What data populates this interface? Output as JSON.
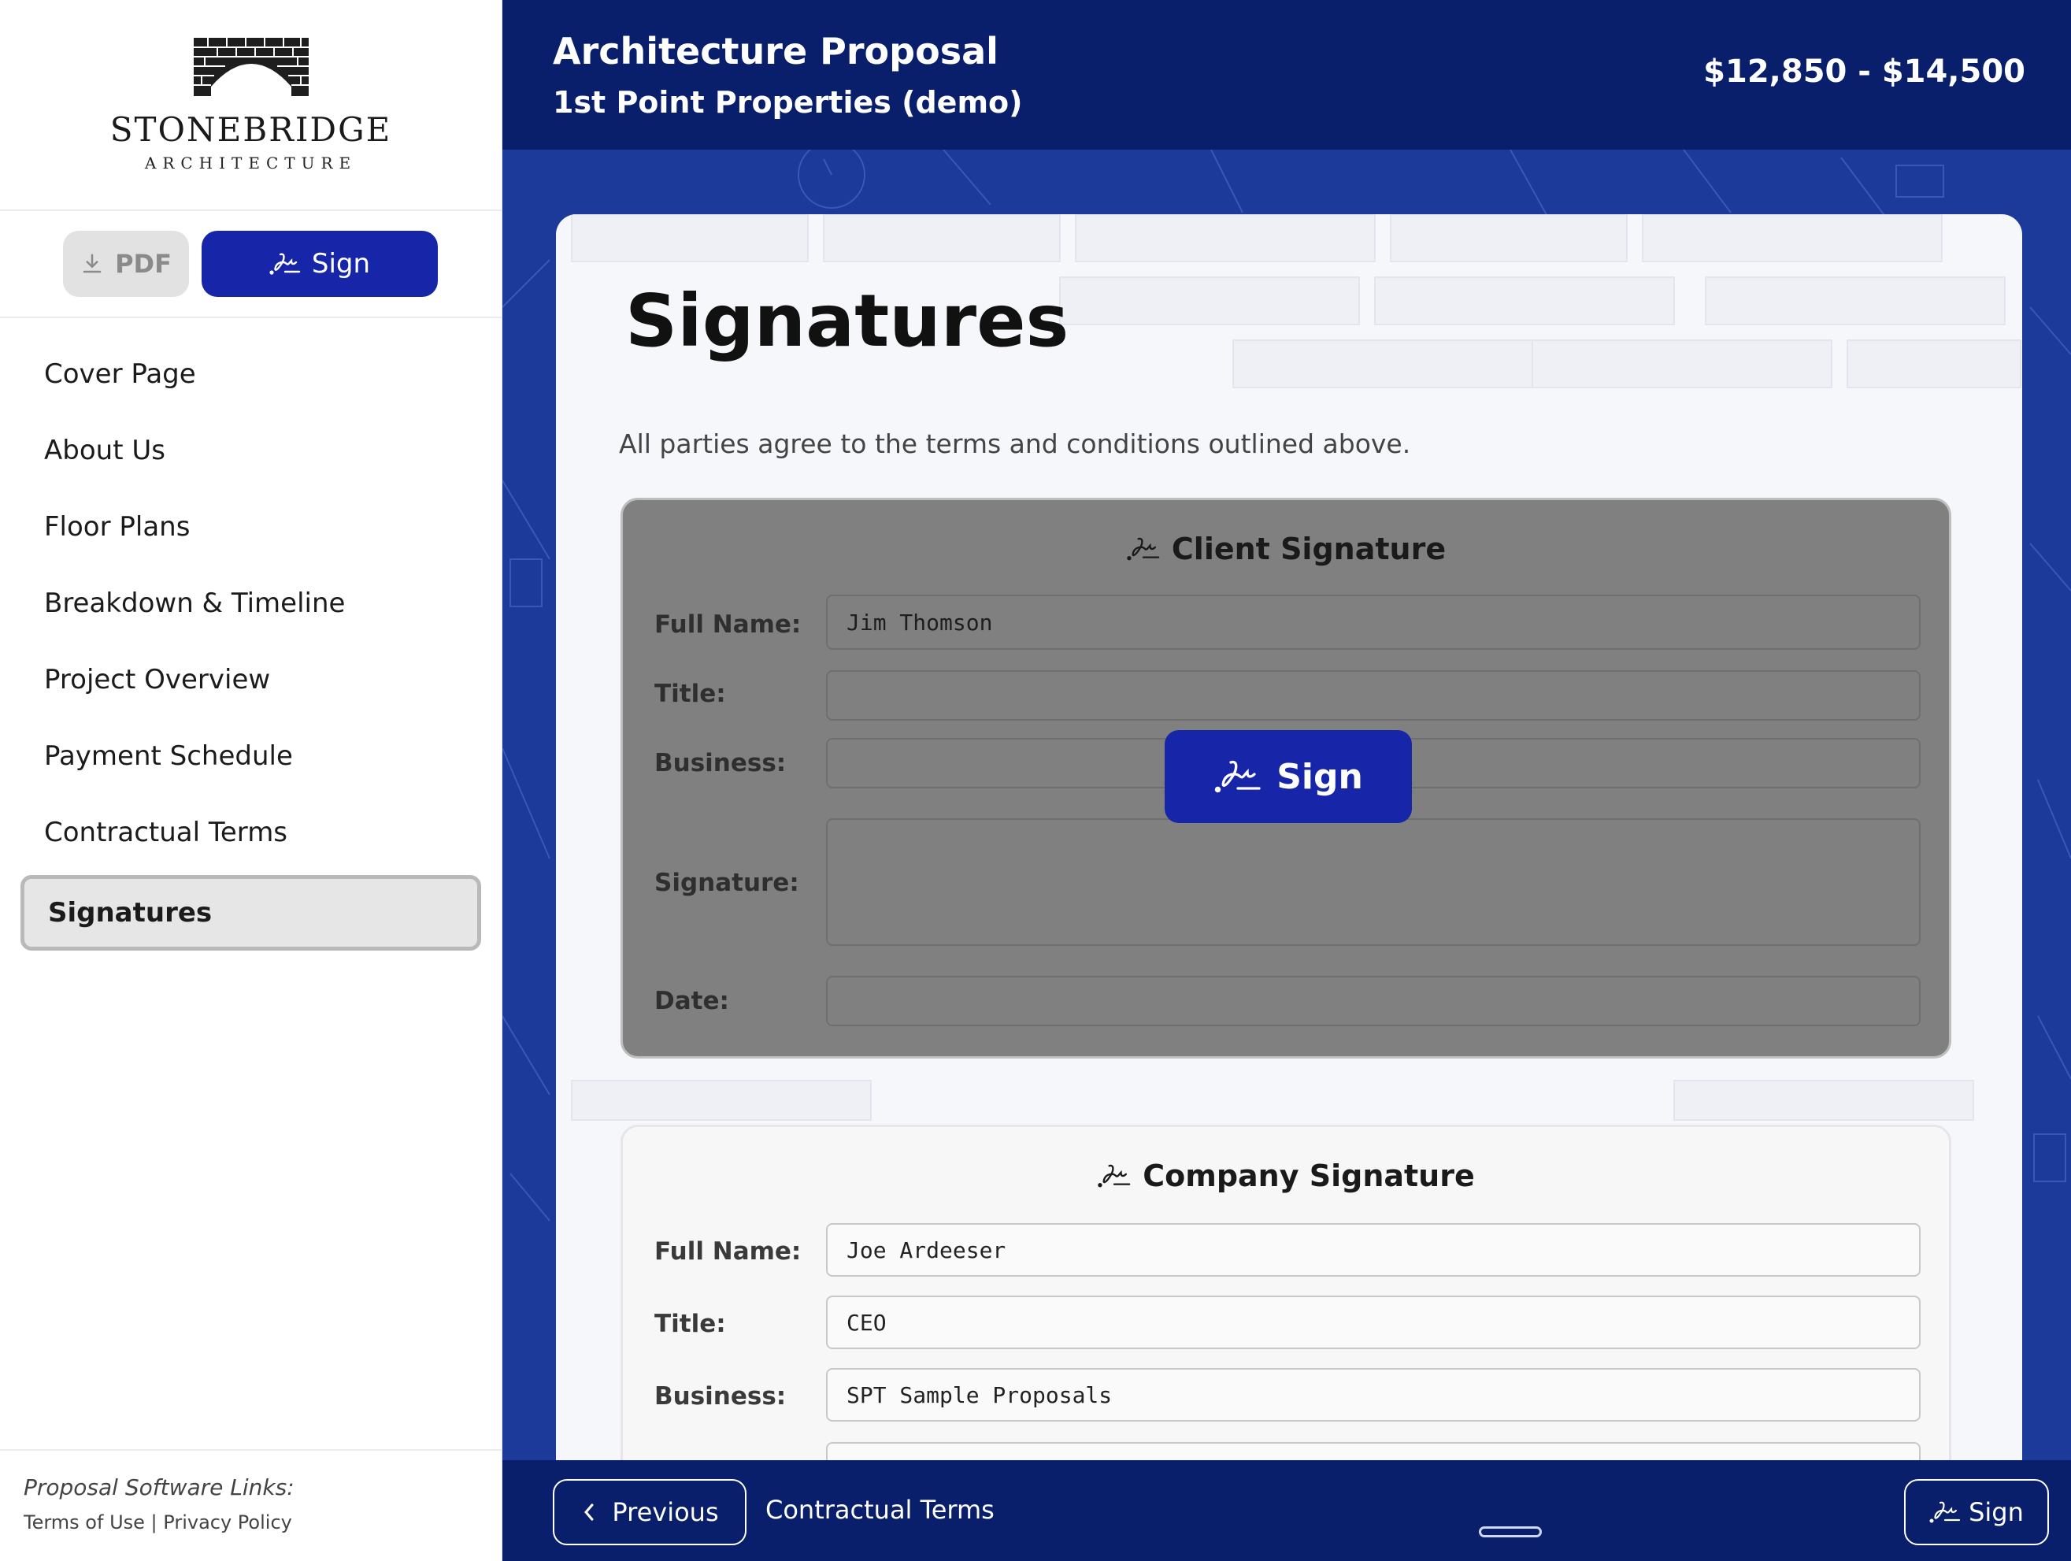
{
  "brand": {
    "name": "STONEBRIDGE",
    "subtitle": "ARCHITECTURE"
  },
  "sidebar": {
    "pdf_label": "PDF",
    "sign_label": "Sign",
    "nav": [
      {
        "label": "Cover Page"
      },
      {
        "label": "About Us"
      },
      {
        "label": "Floor Plans"
      },
      {
        "label": "Breakdown & Timeline"
      },
      {
        "label": "Project Overview"
      },
      {
        "label": "Payment Schedule"
      },
      {
        "label": "Contractual Terms"
      },
      {
        "label": "Signatures",
        "active": true
      }
    ],
    "footer": {
      "heading": "Proposal Software Links:",
      "terms": "Terms of Use",
      "separator": "|",
      "privacy": "Privacy Policy"
    }
  },
  "header": {
    "title": "Architecture Proposal",
    "client": "1st Point Properties (demo)",
    "price": "$12,850 - $14,500"
  },
  "main": {
    "title": "Signatures",
    "description": "All parties agree to the terms and conditions outlined above.",
    "client_box": {
      "heading": "Client Signature",
      "labels": {
        "full_name": "Full Name:",
        "title": "Title:",
        "business": "Business:",
        "signature": "Signature:",
        "date": "Date:"
      },
      "values": {
        "full_name": "Jim Thomson",
        "title": "",
        "business": "",
        "signature": "",
        "date": ""
      },
      "sign_button": "Sign"
    },
    "company_box": {
      "heading": "Company Signature",
      "labels": {
        "full_name": "Full Name:",
        "title": "Title:",
        "business": "Business:"
      },
      "values": {
        "full_name": "Joe Ardeeser",
        "title": "CEO",
        "business": "SPT Sample Proposals"
      }
    }
  },
  "bottombar": {
    "previous_label": "Previous",
    "previous_section": "Contractual Terms",
    "sign_label": "Sign"
  },
  "colors": {
    "primary": "#1726a8",
    "header_bg": "#0a1f6b",
    "blueprint_bg": "#1b3a9a",
    "overlay_gray": "#808080"
  },
  "icons": {
    "pdf": "download-icon",
    "sign": "signature-icon",
    "previous": "chevron-left-icon"
  }
}
